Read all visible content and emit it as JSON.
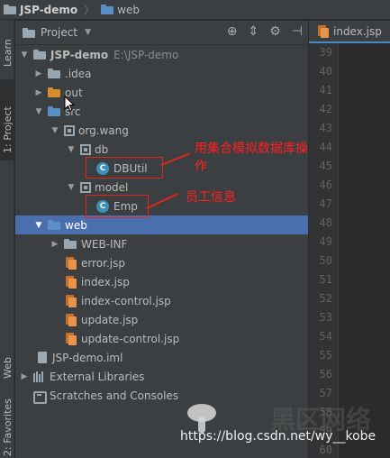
{
  "breadcrumb": {
    "project": "JSP-demo",
    "folder": "web"
  },
  "sidebar_tabs": {
    "learn": "Learn",
    "project": "1: Project",
    "web": "Web",
    "favorites": "2: Favorites"
  },
  "panel": {
    "title": "Project"
  },
  "tree": {
    "root": {
      "name": "JSP-demo",
      "path": "E:\\JSP-demo"
    },
    "idea": ".idea",
    "out": "out",
    "src": "src",
    "pkg": "org.wang",
    "db": "db",
    "dbutil": "DBUtil",
    "model": "model",
    "emp": "Emp",
    "web": "web",
    "webinf": "WEB-INF",
    "files": [
      "error.jsp",
      "index.jsp",
      "index-control.jsp",
      "update.jsp",
      "update-control.jsp"
    ],
    "iml": "JSP-demo.iml",
    "libs": "External Libraries",
    "scratches": "Scratches and Consoles"
  },
  "annotations": {
    "dbutil_note": "用集合模拟数据库操作",
    "emp_note": "员工信息"
  },
  "editor": {
    "tab": "index.jsp",
    "lines": [
      "39",
      "40",
      "41",
      "42",
      "43",
      "44",
      "45",
      "46",
      "47",
      "48",
      "49",
      "50",
      "51",
      "52",
      "53",
      "54",
      "55",
      "56",
      "57",
      "58",
      "59",
      "60"
    ]
  },
  "watermark": {
    "url": "https://blog.csdn.net/wy__kobe",
    "cn": "黑区网络"
  },
  "colors": {
    "selection": "#4b6eaf",
    "annotation": "#e0251d",
    "folder_orange": "#d98c2b",
    "folder_blue": "#5a8fc8"
  }
}
